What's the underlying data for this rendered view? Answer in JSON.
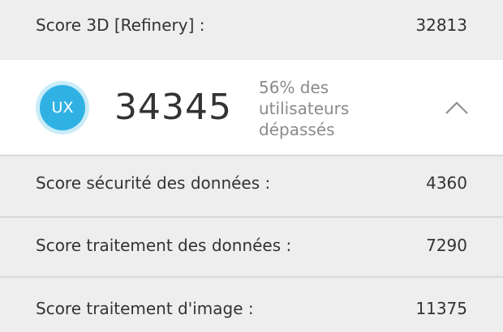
{
  "rows": {
    "score_3d": {
      "label": "Score 3D [Refinery] :",
      "value": "32813"
    },
    "security": {
      "label": "Score sécurité des données :",
      "value": "4360"
    },
    "data_processing": {
      "label": "Score traitement des données :",
      "value": "7290"
    },
    "image_processing": {
      "label": "Score traitement d'image :",
      "value": "11375"
    }
  },
  "ux": {
    "badge": "UX",
    "score": "34345",
    "percent_line1": "56% des",
    "percent_line2": "utilisateurs",
    "percent_line3": "dépassés",
    "collapse_icon": "chevron-up-icon",
    "badge_color": "#2fb2e3",
    "badge_ring_color": "#c9ecf8"
  }
}
